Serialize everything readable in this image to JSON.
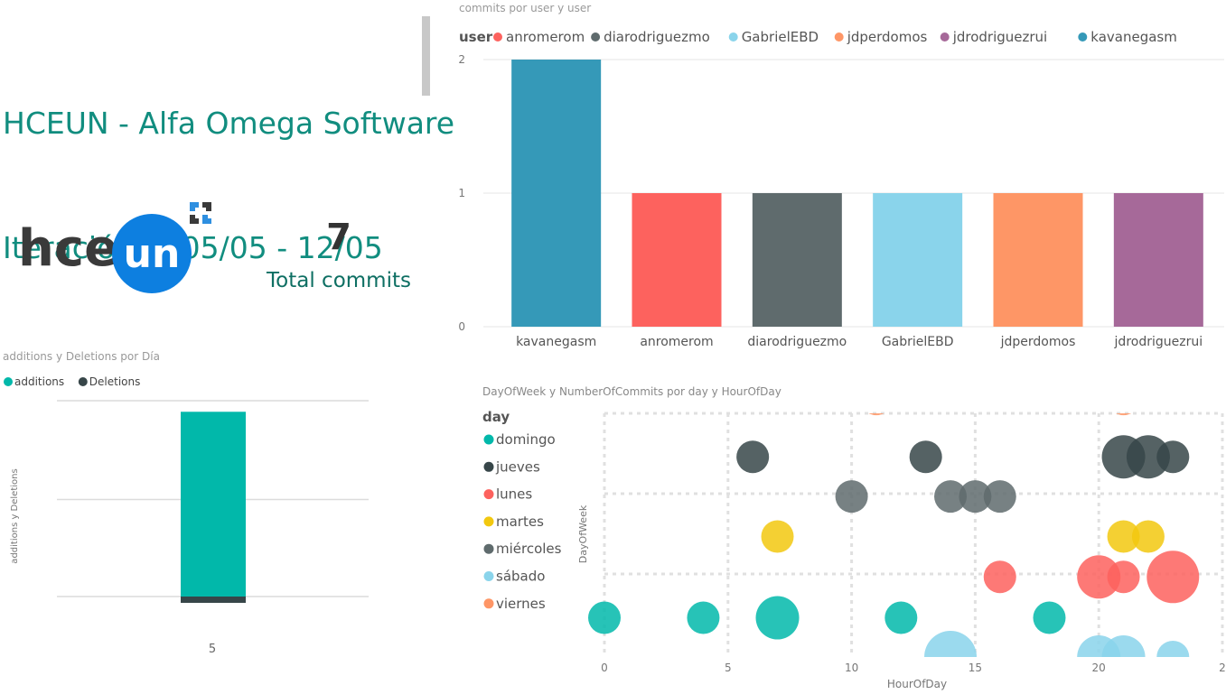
{
  "header": {
    "title_line1": "HCEUN - Alfa Omega Software",
    "title_line2": "Iteración 4  05/05 - 12/05"
  },
  "logo": {
    "text_left": "hce",
    "text_badge": "un",
    "badge_color": "#0d7fe0"
  },
  "kpi": {
    "value": "7",
    "label": "Total commits"
  },
  "colors": {
    "teal": "#01b8aa",
    "dark": "#374649",
    "red": "#fd625e",
    "yellow": "#f2c80f",
    "gray": "#5f6b6d",
    "lightblue": "#8ad4eb",
    "orange": "#fe9666",
    "purple": "#a66999",
    "bluebar": "#3599b8",
    "title": "#118d7f"
  },
  "chart_data": [
    {
      "id": "commits_by_user",
      "type": "bar",
      "title": "commits por user y user",
      "legend_title": "user",
      "legend": [
        {
          "name": "anromerom",
          "color": "#fd625e"
        },
        {
          "name": "diarodriguezmo",
          "color": "#5f6b6d"
        },
        {
          "name": "GabrielEBD",
          "color": "#8ad4eb"
        },
        {
          "name": "jdperdomos",
          "color": "#fe9666"
        },
        {
          "name": "jdrodriguezrui",
          "color": "#a66999"
        },
        {
          "name": "kavanegasm",
          "color": "#3599b8"
        }
      ],
      "categories": [
        "kavanegasm",
        "anromerom",
        "diarodriguezmo",
        "GabrielEBD",
        "jdperdomos",
        "jdrodriguezrui"
      ],
      "values": [
        2,
        1,
        1,
        1,
        1,
        1
      ],
      "bar_colors": [
        "#3599b8",
        "#fd625e",
        "#5f6b6d",
        "#8ad4eb",
        "#fe9666",
        "#a66999"
      ],
      "ylim": [
        0,
        2
      ],
      "yticks": [
        "0",
        "1",
        "2"
      ],
      "grid": true
    },
    {
      "id": "additions_deletions",
      "type": "bar",
      "stacked": true,
      "title": "additions y Deletions por Día",
      "legend": [
        {
          "name": "additions",
          "color": "#01b8aa"
        },
        {
          "name": "Deletions",
          "color": "#374649"
        }
      ],
      "categories": [
        "5"
      ],
      "series": [
        {
          "name": "additions",
          "values": [
            1000
          ]
        },
        {
          "name": "Deletions",
          "values": [
            -35
          ]
        }
      ],
      "ylabel": "additions y Deletions",
      "ylim": [
        -40,
        1060
      ],
      "grid": true
    },
    {
      "id": "dayofweek_scatter",
      "type": "scatter",
      "title": "DayOfWeek y NumberOfCommits por day y HourOfDay",
      "xlabel": "HourOfDay",
      "ylabel": "DayOfWeek",
      "xlim": [
        0,
        25
      ],
      "xticks": [
        "0",
        "5",
        "10",
        "15",
        "20",
        "2"
      ],
      "legend_title": "day",
      "legend": [
        {
          "name": "domingo",
          "color": "#01b8aa"
        },
        {
          "name": "jueves",
          "color": "#374649"
        },
        {
          "name": "lunes",
          "color": "#fd625e"
        },
        {
          "name": "martes",
          "color": "#f2c80f"
        },
        {
          "name": "miércoles",
          "color": "#5f6b6d"
        },
        {
          "name": "sábado",
          "color": "#8ad4eb"
        },
        {
          "name": "viernes",
          "color": "#fe9666"
        }
      ],
      "series": [
        {
          "name": "viernes",
          "day_index": 6,
          "points": [
            {
              "x": 11,
              "size": 1
            },
            {
              "x": 21,
              "size": 1
            }
          ]
        },
        {
          "name": "jueves",
          "day_index": 5,
          "points": [
            {
              "x": 6,
              "size": 1
            },
            {
              "x": 13,
              "size": 1
            },
            {
              "x": 21,
              "size": 2
            },
            {
              "x": 22,
              "size": 2
            },
            {
              "x": 23,
              "size": 1
            }
          ]
        },
        {
          "name": "miércoles",
          "day_index": 4,
          "points": [
            {
              "x": 10,
              "size": 1
            },
            {
              "x": 14,
              "size": 1
            },
            {
              "x": 15,
              "size": 1
            },
            {
              "x": 16,
              "size": 1
            }
          ]
        },
        {
          "name": "martes",
          "day_index": 3,
          "points": [
            {
              "x": 7,
              "size": 1
            },
            {
              "x": 21,
              "size": 1
            },
            {
              "x": 22,
              "size": 1
            }
          ]
        },
        {
          "name": "lunes",
          "day_index": 2,
          "points": [
            {
              "x": 16,
              "size": 1
            },
            {
              "x": 20,
              "size": 2
            },
            {
              "x": 21,
              "size": 1
            },
            {
              "x": 23,
              "size": 3
            }
          ]
        },
        {
          "name": "domingo",
          "day_index": 1,
          "points": [
            {
              "x": 0,
              "size": 1
            },
            {
              "x": 4,
              "size": 1
            },
            {
              "x": 7,
              "size": 2
            },
            {
              "x": 12,
              "size": 1
            },
            {
              "x": 18,
              "size": 1
            }
          ]
        },
        {
          "name": "sábado",
          "day_index": 0,
          "points": [
            {
              "x": 14,
              "size": 3
            },
            {
              "x": 20,
              "size": 2
            },
            {
              "x": 21,
              "size": 2
            },
            {
              "x": 23,
              "size": 1
            }
          ]
        }
      ]
    }
  ]
}
